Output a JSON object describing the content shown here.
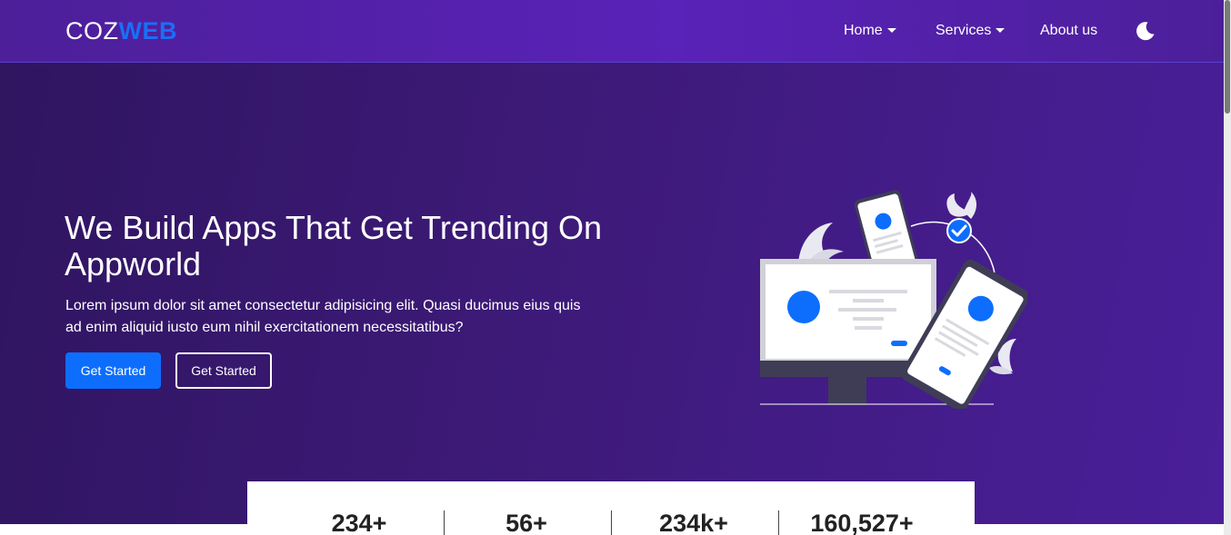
{
  "navbar": {
    "logo_part1": "COZ",
    "logo_part2": "WEB",
    "items": [
      {
        "label": "Home",
        "has_dropdown": true
      },
      {
        "label": "Services",
        "has_dropdown": true
      },
      {
        "label": "About us",
        "has_dropdown": false
      }
    ],
    "theme_toggle_icon": "moon-icon"
  },
  "hero": {
    "title": "We Build Apps That Get Trending On Appworld",
    "text": "Lorem ipsum dolor sit amet consectetur adipisicing elit. Quasi ducimus eius quis ad enim aliquid iusto eum nihil exercitationem necessitatibus?",
    "buttons": [
      {
        "label": "Get Started"
      },
      {
        "label": "Get Started"
      }
    ]
  },
  "stats": [
    {
      "value": "234+"
    },
    {
      "value": "56+"
    },
    {
      "value": "234k+"
    },
    {
      "value": "160,527+"
    }
  ],
  "colors": {
    "accent": "#0d6efd",
    "logo_accent": "#1a6ff5",
    "navbar_bg": "#5922b8",
    "hero_bg": "#3d1a78"
  }
}
